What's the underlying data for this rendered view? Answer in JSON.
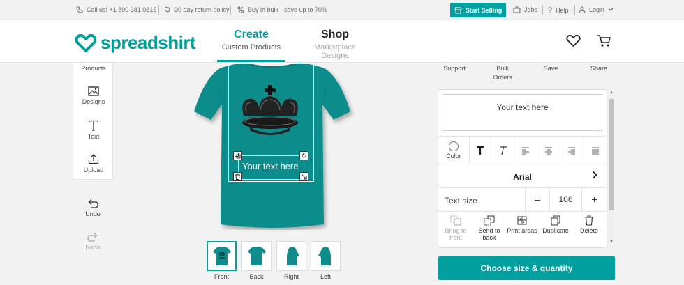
{
  "colors": {
    "accent": "#00a0a0",
    "shirt": "#118c8c"
  },
  "topbar": {
    "phone": "Call us! +1 800 381 0815",
    "returns": "30 day return policy",
    "bulk": "Buy in bulk - save up to 70%",
    "start_selling": "Start Selling",
    "jobs": "Jobs",
    "help": "Help",
    "login": "Login"
  },
  "header": {
    "logo": "spreadshirt",
    "tab_create": {
      "title": "Create",
      "subtitle": "Custom Products"
    },
    "tab_shop": {
      "title": "Shop",
      "subtitle": "Marketplace Designs"
    }
  },
  "left_panel": {
    "items": [
      {
        "label": "Products",
        "icon": "tshirt-icon"
      },
      {
        "label": "Designs",
        "icon": "image-icon"
      },
      {
        "label": "Text",
        "icon": "text-icon"
      },
      {
        "label": "Upload",
        "icon": "upload-icon"
      }
    ],
    "undo": "Undo",
    "redo": "Redo"
  },
  "canvas": {
    "text": "Your text here"
  },
  "views": [
    {
      "label": "Front"
    },
    {
      "label": "Back"
    },
    {
      "label": "Right"
    },
    {
      "label": "Left"
    }
  ],
  "right_top": {
    "support": "Support",
    "bulk_orders": "Bulk\nOrders",
    "save": "Save",
    "share": "Share"
  },
  "text_editor": {
    "input_value": "Your text here",
    "color_label": "Color",
    "font": "Arial",
    "size_label": "Text size",
    "size_value": "106",
    "minus": "–",
    "plus": "+",
    "actions": [
      {
        "label": "Bring to front",
        "disabled": true
      },
      {
        "label": "Send to back",
        "disabled": false
      },
      {
        "label": "Print areas",
        "disabled": false
      },
      {
        "label": "Duplicate",
        "disabled": false
      },
      {
        "label": "Delete",
        "disabled": false
      }
    ]
  },
  "choose_button": "Choose size & quantity"
}
